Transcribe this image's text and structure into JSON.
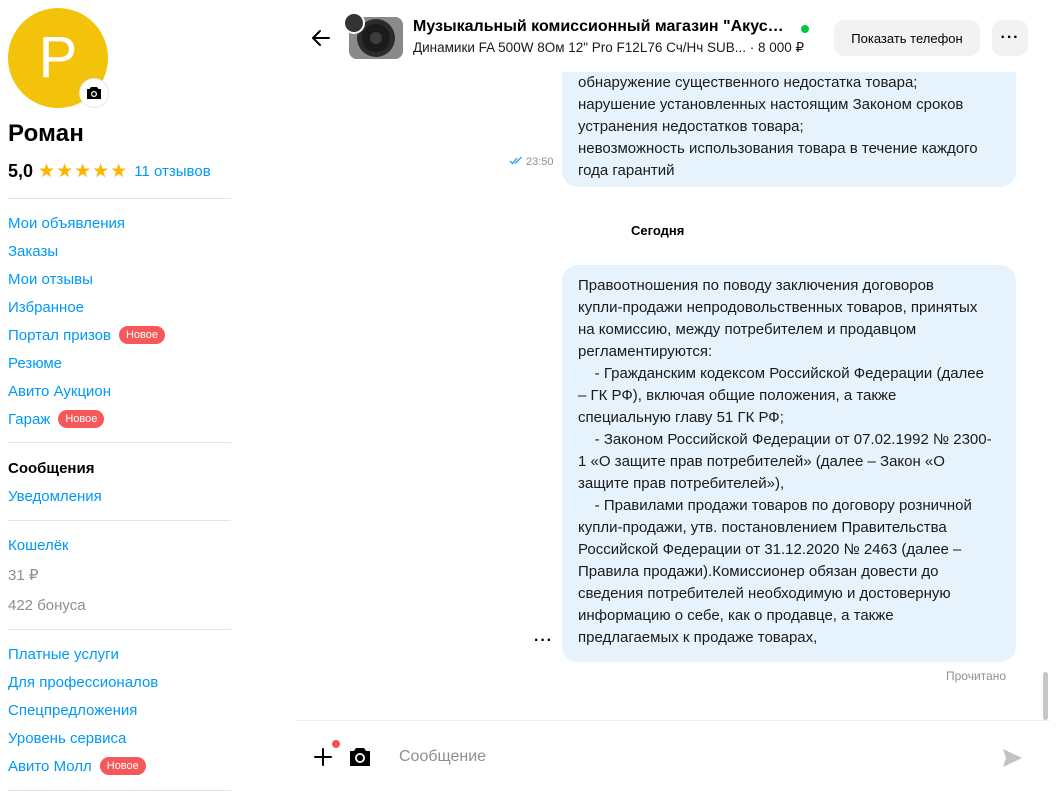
{
  "profile": {
    "avatar_letter": "Р",
    "name": "Роман",
    "rating": "5,0",
    "stars": 5,
    "reviews": "11 отзывов"
  },
  "nav": {
    "my_ads": "Мои объявления",
    "orders": "Заказы",
    "my_reviews": "Мои отзывы",
    "favorites": "Избранное",
    "prizes": "Портал призов",
    "resume": "Резюме",
    "auction": "Авито Аукцион",
    "garage": "Гараж",
    "messages": "Сообщения",
    "notifications": "Уведомления",
    "wallet": "Кошелёк",
    "balance": "31 ₽",
    "bonus": "422 бонуса",
    "paid_services": "Платные услуги",
    "pro": "Для профессионалов",
    "special": "Спецпредложения",
    "service_level": "Уровень сервиса",
    "mall": "Авито Молл",
    "new_badge": "Новое"
  },
  "chat": {
    "title": "Музыкальный комиссионный магазин \"Акустика\"",
    "subtitle": "Динамики FA 500W 8Ом 12\" Pro F12L76 Сч/Нч SUB... · 8 000 ₽",
    "show_phone": "Показать телефон",
    "more": "···"
  },
  "messages": {
    "msg1_lines": [
      "обнаружение существенного недостатка товара;",
      "нарушение установленных настоящим Законом сроков",
      "устранения недостатков товара;",
      "невозможность использования товара в течение каждого",
      "года гарантий"
    ],
    "msg1_time": "23:50",
    "date_separator": "Сегодня",
    "msg2_lines": [
      "Правоотношения по поводу заключения договоров",
      "купли-продажи непродовольственных товаров, принятых",
      "на комиссию, между потребителем и продавцом",
      "регламентируются:",
      "    - Гражданским кодексом Российской Федерации (далее",
      "– ГК РФ), включая общие положения, а также",
      "специальную главу 51 ГК РФ;",
      "    - Законом Российской Федерации от 07.02.1992 № 2300-",
      "1 «О защите прав потребителей» (далее – Закон «О",
      "защите прав потребителей»),",
      "    - Правилами продажи товаров по договору розничной",
      "купли-продажи, утв. постановлением Правительства",
      "Российской Федерации от 31.12.2020 № 2463 (далее –",
      "Правила продажи).Комиссионер обязан довести до",
      "сведения потребителей необходимую и достоверную",
      "информацию о себе, как о продавце, а также",
      "предлагаемых к продаже товарах,"
    ],
    "msg_more": "···",
    "read_status": "Прочитано"
  },
  "composer": {
    "placeholder": "Сообщение"
  },
  "colors": {
    "link": "#0099f7",
    "avatar": "#f3c20b",
    "bubble": "#e6f3fc",
    "badge": "#f5585a",
    "online": "#00c83a",
    "star": "#fdb400"
  }
}
